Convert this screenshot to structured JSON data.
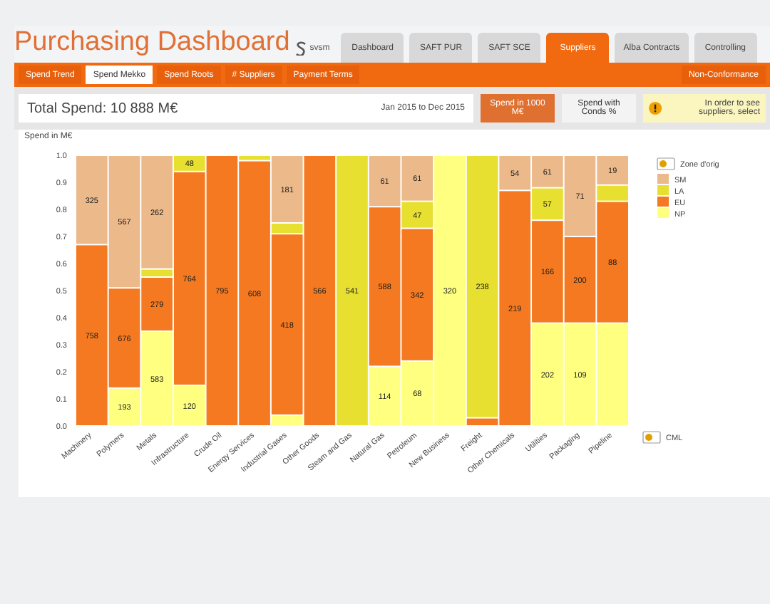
{
  "header": {
    "title": "Purchasing Dashboard",
    "logo_text": "svsm"
  },
  "tabs": [
    {
      "label": "Dashboard",
      "selected": false
    },
    {
      "label": "SAFT PUR",
      "selected": false
    },
    {
      "label": "SAFT SCE",
      "selected": false
    },
    {
      "label": "Suppliers",
      "selected": true
    },
    {
      "label": "Alba Contracts",
      "selected": false
    },
    {
      "label": "Controlling",
      "selected": false
    }
  ],
  "subtabs": [
    {
      "label": "Spend Trend",
      "selected": false
    },
    {
      "label": "Spend Mekko",
      "selected": true
    },
    {
      "label": "Spend Roots",
      "selected": false
    },
    {
      "label": "# Suppliers",
      "selected": false
    },
    {
      "label": "Payment Terms",
      "selected": false
    }
  ],
  "subtab_right": "Non-Conformance",
  "summary": {
    "total_label": "Total Spend:",
    "total_value": "10 888 M€",
    "period": "Jan 2015 to Dec 2015"
  },
  "buttons": [
    {
      "label": "Spend in 1000 M€",
      "selected": true
    },
    {
      "label": "Spend with Conds %",
      "selected": false
    }
  ],
  "warning": "In order to see suppliers, select",
  "chart_panel": {
    "label": "Spend in M€",
    "footer_toggle": "CML",
    "chart_data": {
      "type": "bar",
      "stacked": true,
      "orientation": "vertical",
      "ylim": [
        0,
        1
      ],
      "legend": {
        "title": "Zone d'orig"
      },
      "yticks": [
        {
          "value": 0,
          "label": "0.0"
        },
        {
          "value": 0.1,
          "label": "0.1"
        },
        {
          "value": 0.2,
          "label": "0.2"
        },
        {
          "value": 0.3,
          "label": "0.3"
        },
        {
          "value": 0.4,
          "label": "0.4"
        },
        {
          "value": 0.5,
          "label": "0.5"
        },
        {
          "value": 0.6,
          "label": "0.6"
        },
        {
          "value": 0.7,
          "label": "0.7"
        },
        {
          "value": 0.8,
          "label": "0.8"
        },
        {
          "value": 0.9,
          "label": "0.9"
        },
        {
          "value": 1,
          "label": "1.0"
        }
      ],
      "categories": [
        "Machinery",
        "Polymers",
        "Metals",
        "Infrastructure",
        "Crude Oil",
        "Energy Services",
        "Industrial Gases",
        "Other Goods",
        "Steam and Gas",
        "Natural Gas",
        "Petroleum",
        "New Business",
        "Freight",
        "Other Chemicals",
        "Utilities",
        "Packaging",
        "Pipeline"
      ],
      "series": [
        {
          "name": "NP",
          "color": "#ffff80",
          "values": [
            0,
            0.14,
            0.35,
            0.15,
            0,
            0,
            0.04,
            0,
            0,
            0.22,
            0.24,
            1,
            0,
            0,
            0.38,
            0.38,
            0.38
          ]
        },
        {
          "name": "EU",
          "color": "#f47920",
          "values": [
            0.67,
            0.37,
            0.2,
            0.79,
            1,
            0.98,
            0.67,
            1,
            0,
            0.59,
            0.49,
            0,
            0.03,
            0.87,
            0.38,
            0.32,
            0.45
          ]
        },
        {
          "name": "LA",
          "color": "#e8e030",
          "values": [
            0,
            0,
            0.03,
            0.06,
            0,
            0.02,
            0.04,
            0,
            1,
            0,
            0.1,
            0,
            0.97,
            0,
            0.12,
            0,
            0.06
          ]
        },
        {
          "name": "SM",
          "color": "#ebb98a",
          "values": [
            0.33,
            0.49,
            0.42,
            0,
            0,
            0,
            0.25,
            0,
            0,
            0.19,
            0.17,
            0,
            0,
            0.13,
            0.12,
            0.3,
            0.11
          ]
        }
      ],
      "value_labels": [
        [
          null,
          "193",
          "583",
          "120",
          null,
          null,
          null,
          null,
          null,
          "114",
          "68",
          "320",
          null,
          null,
          "202",
          "109",
          null
        ],
        [
          "758",
          "676",
          "279",
          "764",
          "795",
          "608",
          "418",
          "566",
          null,
          "588",
          "342",
          null,
          null,
          "219",
          "166",
          "200",
          "88"
        ],
        [
          null,
          null,
          null,
          "48",
          null,
          null,
          null,
          null,
          "541",
          null,
          "47",
          null,
          "238",
          null,
          "57",
          null,
          null
        ],
        [
          "325",
          "567",
          "262",
          null,
          null,
          null,
          "181",
          null,
          null,
          "61",
          "61",
          null,
          null,
          "54",
          "61",
          "71",
          "19"
        ]
      ]
    }
  }
}
